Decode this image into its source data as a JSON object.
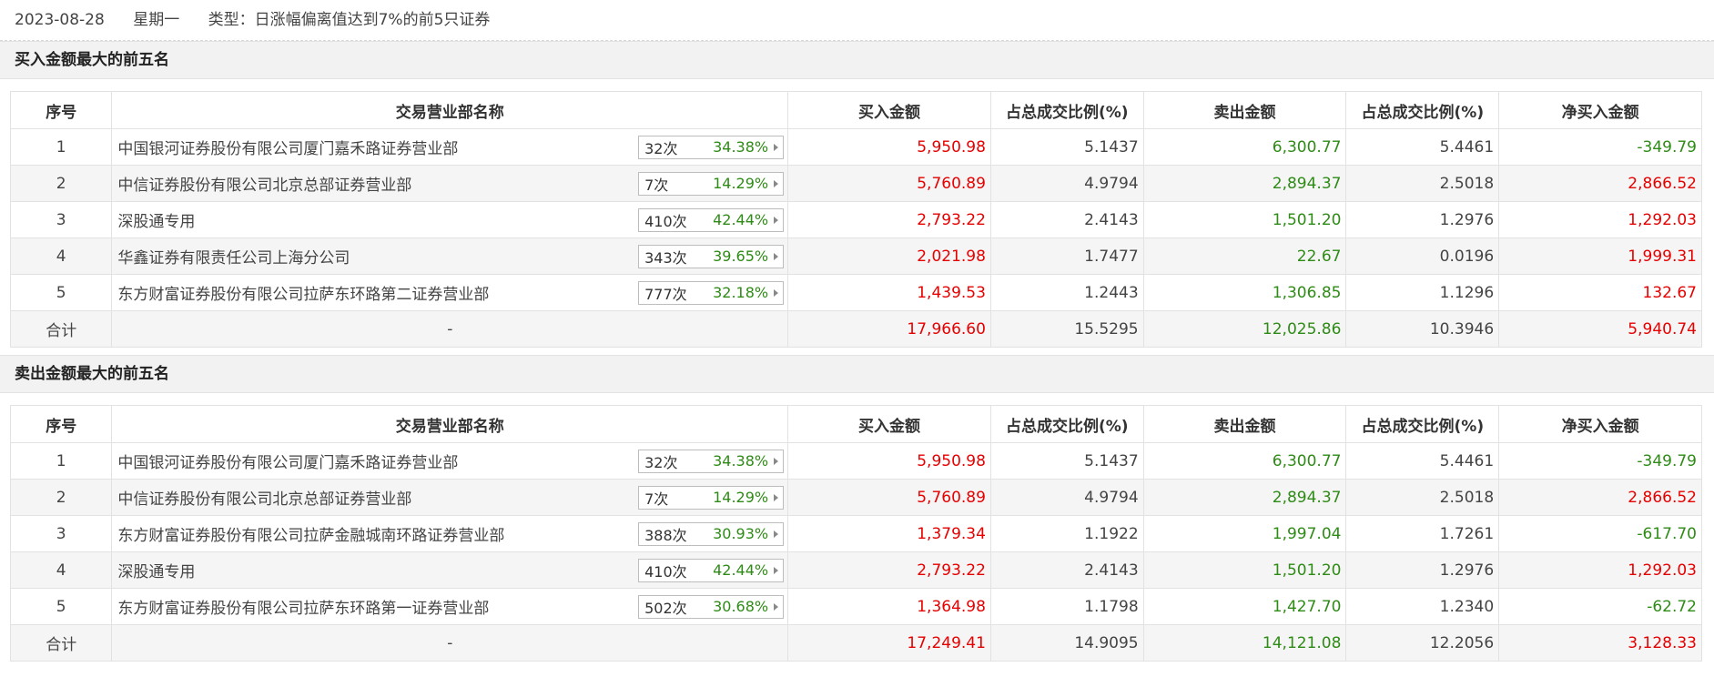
{
  "header": {
    "date": "2023-08-28",
    "weekday": "星期一",
    "type": "类型：日涨幅偏离值达到7%的前5只证券"
  },
  "columns": [
    "序号",
    "交易营业部名称",
    "买入金额",
    "占总成交比例(%)",
    "卖出金额",
    "占总成交比例(%)",
    "净买入金额"
  ],
  "colors": {
    "up": "#e60000",
    "down": "#2e8b16"
  },
  "sections": [
    {
      "title": "买入金额最大的前五名",
      "rows": [
        {
          "idx": "1",
          "name": "中国银河证券股份有限公司厦门嘉禾路证券营业部",
          "count": "32次",
          "pct": "34.38%",
          "buy": "5,950.98",
          "buy_ratio": "5.1437",
          "sell": "6,300.77",
          "sell_ratio": "5.4461",
          "net": "-349.79"
        },
        {
          "idx": "2",
          "name": "中信证券股份有限公司北京总部证券营业部",
          "count": "7次",
          "pct": "14.29%",
          "buy": "5,760.89",
          "buy_ratio": "4.9794",
          "sell": "2,894.37",
          "sell_ratio": "2.5018",
          "net": "2,866.52"
        },
        {
          "idx": "3",
          "name": "深股通专用",
          "count": "410次",
          "pct": "42.44%",
          "buy": "2,793.22",
          "buy_ratio": "2.4143",
          "sell": "1,501.20",
          "sell_ratio": "1.2976",
          "net": "1,292.03"
        },
        {
          "idx": "4",
          "name": "华鑫证券有限责任公司上海分公司",
          "count": "343次",
          "pct": "39.65%",
          "buy": "2,021.98",
          "buy_ratio": "1.7477",
          "sell": "22.67",
          "sell_ratio": "0.0196",
          "net": "1,999.31"
        },
        {
          "idx": "5",
          "name": "东方财富证券股份有限公司拉萨东环路第二证券营业部",
          "count": "777次",
          "pct": "32.18%",
          "buy": "1,439.53",
          "buy_ratio": "1.2443",
          "sell": "1,306.85",
          "sell_ratio": "1.1296",
          "net": "132.67"
        }
      ],
      "total": {
        "label": "合计",
        "name": "-",
        "buy": "17,966.60",
        "buy_ratio": "15.5295",
        "sell": "12,025.86",
        "sell_ratio": "10.3946",
        "net": "5,940.74"
      }
    },
    {
      "title": "卖出金额最大的前五名",
      "rows": [
        {
          "idx": "1",
          "name": "中国银河证券股份有限公司厦门嘉禾路证券营业部",
          "count": "32次",
          "pct": "34.38%",
          "buy": "5,950.98",
          "buy_ratio": "5.1437",
          "sell": "6,300.77",
          "sell_ratio": "5.4461",
          "net": "-349.79"
        },
        {
          "idx": "2",
          "name": "中信证券股份有限公司北京总部证券营业部",
          "count": "7次",
          "pct": "14.29%",
          "buy": "5,760.89",
          "buy_ratio": "4.9794",
          "sell": "2,894.37",
          "sell_ratio": "2.5018",
          "net": "2,866.52"
        },
        {
          "idx": "3",
          "name": "东方财富证券股份有限公司拉萨金融城南环路证券营业部",
          "count": "388次",
          "pct": "30.93%",
          "buy": "1,379.34",
          "buy_ratio": "1.1922",
          "sell": "1,997.04",
          "sell_ratio": "1.7261",
          "net": "-617.70"
        },
        {
          "idx": "4",
          "name": "深股通专用",
          "count": "410次",
          "pct": "42.44%",
          "buy": "2,793.22",
          "buy_ratio": "2.4143",
          "sell": "1,501.20",
          "sell_ratio": "1.2976",
          "net": "1,292.03"
        },
        {
          "idx": "5",
          "name": "东方财富证券股份有限公司拉萨东环路第一证券营业部",
          "count": "502次",
          "pct": "30.68%",
          "buy": "1,364.98",
          "buy_ratio": "1.1798",
          "sell": "1,427.70",
          "sell_ratio": "1.2340",
          "net": "-62.72"
        }
      ],
      "total": {
        "label": "合计",
        "name": "-",
        "buy": "17,249.41",
        "buy_ratio": "14.9095",
        "sell": "14,121.08",
        "sell_ratio": "12.2056",
        "net": "3,128.33"
      }
    }
  ]
}
